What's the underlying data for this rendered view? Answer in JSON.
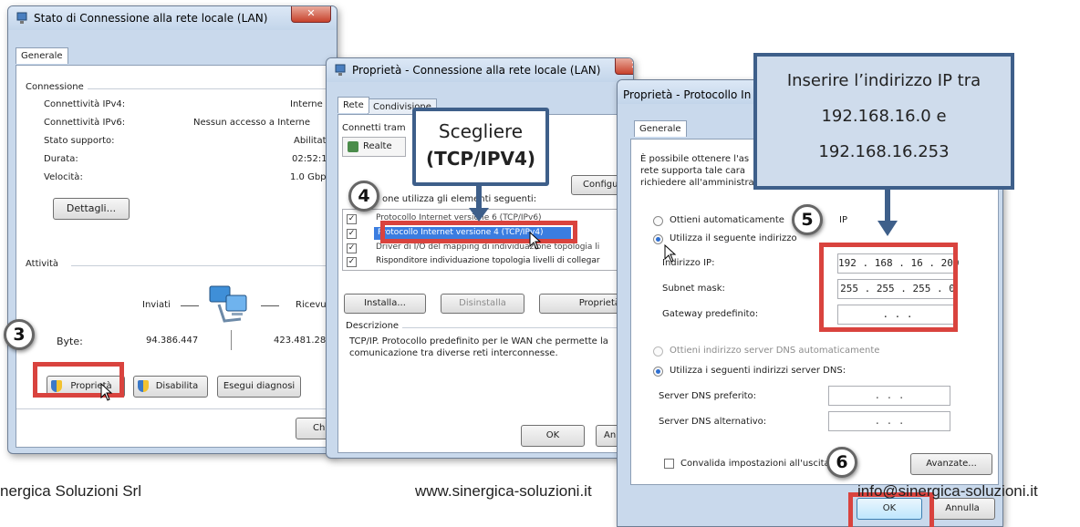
{
  "win1": {
    "title": "Stato di Connessione alla rete locale (LAN)",
    "tab": "Generale",
    "group_connessione": "Connessione",
    "rows": [
      {
        "label": "Connettività IPv4:",
        "value": "Interne"
      },
      {
        "label": "Connettività IPv6:",
        "value": "Nessun accesso a Interne"
      },
      {
        "label": "Stato supporto:",
        "value": "Abilitat"
      },
      {
        "label": "Durata:",
        "value": "02:52:1"
      },
      {
        "label": "Velocità:",
        "value": "1.0 Gbp"
      }
    ],
    "details_button": "Dettagli...",
    "group_attivita": "Attività",
    "sent_label": "Inviati",
    "received_label": "Ricevu",
    "bytes_label": "Byte:",
    "bytes_sent": "94.386.447",
    "bytes_received": "423.481.28",
    "properties_button": "Proprietà",
    "disable_button": "Disabilita",
    "diagnose_button": "Esegui diagnosi",
    "close_button": "Chi"
  },
  "win2": {
    "title": "Proprietà - Connessione alla rete locale (LAN)",
    "tab_rete": "Rete",
    "tab_condivisione": "Condivisione",
    "connect_using": "Connetti tram",
    "adapter": "Realte",
    "configure_button": "Configura",
    "components_label": "one utilizza gli elementi seguenti:",
    "items": [
      "Protocollo Internet versione 6 (TCP/IPv6)",
      "Protocollo Internet versione 4 (TCP/IPv4)",
      "Driver di I/O del mapping di individuazione topologia li",
      "Risponditore individuazione topologia livelli di collegar"
    ],
    "install_button": "Installa...",
    "uninstall_button": "Disinstalla",
    "properties_button": "Proprietà",
    "description_label": "Descrizione",
    "description_text": "TCP/IP. Protocollo predefinito per le WAN che permette la comunicazione tra diverse reti interconnesse.",
    "ok_button": "OK",
    "cancel_button": "An"
  },
  "win3": {
    "title": "Proprietà - Protocollo In",
    "tab": "Generale",
    "intro_lines": [
      "È possibile ottenere l'as",
      "rete supporta tale cara",
      "richiedere all'amministra"
    ],
    "radio_auto_ip": "Ottieni automaticamente",
    "radio_auto_ip_tail": "IP",
    "radio_manual_ip": "Utilizza il seguente indirizzo",
    "ip_label": "Indirizzo IP:",
    "ip_value": "192 . 168 . 16 . 200",
    "mask_label": "Subnet mask:",
    "mask_value": "255 . 255 . 255 . 0",
    "gateway_label": "Gateway predefinito:",
    "gateway_value": ".      .      .",
    "radio_auto_dns": "Ottieni indirizzo server DNS automaticamente",
    "radio_manual_dns": "Utilizza i seguenti indirizzi server DNS:",
    "dns_pref_label": "Server DNS preferito:",
    "dns_alt_label": "Server DNS alternativo:",
    "dns_empty": ".      .      .",
    "validate_label": "Convalida impostazioni all'uscita",
    "advanced_button": "Avanzate...",
    "ok_button": "OK",
    "cancel_button": "Annulla"
  },
  "callout_tcp": {
    "line1": "Scegliere",
    "line2": "(TCP/IPV4)"
  },
  "callout_ip": {
    "line1": "Inserire l’indirizzo IP tra",
    "line2": "192.168.16.0 e",
    "line3": "192.168.16.253"
  },
  "badges": {
    "b3": "3",
    "b4": "4",
    "b5": "5",
    "b6": "6"
  },
  "footer": {
    "company": "nergica Soluzioni Srl",
    "website": "www.sinergica-soluzioni.it",
    "email": "info@sinergica-soluzioni.it"
  },
  "colors": {
    "accent_red": "#d9433e",
    "callout_border": "#3e5f8a",
    "selection_blue": "#3b7de0"
  }
}
